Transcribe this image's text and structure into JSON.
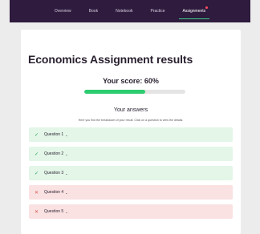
{
  "nav": {
    "items": [
      {
        "label": "Overview"
      },
      {
        "label": "Book"
      },
      {
        "label": "Notebook"
      },
      {
        "label": "Practice"
      },
      {
        "label": "Assignments",
        "active": true,
        "notification": true
      }
    ]
  },
  "results": {
    "title": "Economics Assignment results",
    "score_label": "Your score: 60%",
    "score_percent": 60,
    "answers_heading": "Your answers",
    "answers_description": "Here you find the breakdown of your result. Click on a question to view the details.",
    "questions": [
      {
        "label": "Question 1",
        "status": "correct",
        "icon": "check-icon",
        "chevron": "⌄"
      },
      {
        "label": "Question 2",
        "status": "correct",
        "icon": "check-icon",
        "chevron": "⌄"
      },
      {
        "label": "Question 3",
        "status": "correct",
        "icon": "check-icon",
        "chevron": "⌄"
      },
      {
        "label": "Question 4",
        "status": "wrong",
        "icon": "cross-icon",
        "chevron": "⌄"
      },
      {
        "label": "Question 5",
        "status": "wrong",
        "icon": "cross-icon",
        "chevron": "⌄"
      }
    ]
  },
  "colors": {
    "nav_bg": "#2e1b3d",
    "accent": "#2ecc71",
    "correct_bg": "#e3f6e8",
    "wrong_bg": "#fbe2e2"
  }
}
